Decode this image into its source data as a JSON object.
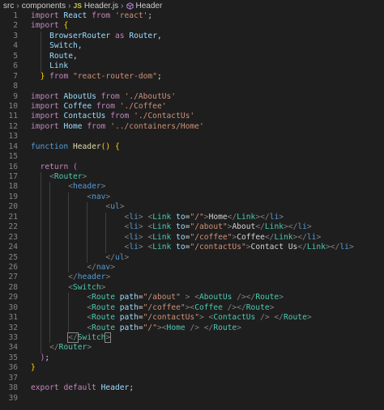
{
  "breadcrumb": {
    "items": [
      "src",
      "components",
      "Header.js",
      "Header"
    ],
    "file_badge": "JS"
  },
  "editor": {
    "lines": [
      {
        "n": "1",
        "tokens": [
          [
            "t-kw",
            "import "
          ],
          [
            "t-var",
            "React"
          ],
          [
            "t-kw",
            " from "
          ],
          [
            "t-str",
            "'react'"
          ],
          [
            "t-txt",
            ";"
          ]
        ]
      },
      {
        "n": "2",
        "tokens": [
          [
            "t-kw",
            "import "
          ],
          [
            "t-brace",
            "{"
          ]
        ]
      },
      {
        "n": "3",
        "tokens": [
          [
            "t-txt",
            "    "
          ],
          [
            "t-var",
            "BrowserRouter"
          ],
          [
            "t-kw",
            " as "
          ],
          [
            "t-var",
            "Router"
          ],
          [
            "t-txt",
            ","
          ]
        ]
      },
      {
        "n": "4",
        "tokens": [
          [
            "t-txt",
            "    "
          ],
          [
            "t-var",
            "Switch"
          ],
          [
            "t-txt",
            ","
          ]
        ]
      },
      {
        "n": "5",
        "tokens": [
          [
            "t-txt",
            "    "
          ],
          [
            "t-var",
            "Route"
          ],
          [
            "t-txt",
            ","
          ]
        ]
      },
      {
        "n": "6",
        "tokens": [
          [
            "t-txt",
            "    "
          ],
          [
            "t-var",
            "Link"
          ]
        ]
      },
      {
        "n": "7",
        "tokens": [
          [
            "t-txt",
            "  "
          ],
          [
            "t-brace",
            "}"
          ],
          [
            "t-kw",
            " from "
          ],
          [
            "t-str",
            "\"react-router-dom\""
          ],
          [
            "t-txt",
            ";"
          ]
        ]
      },
      {
        "n": "8",
        "tokens": []
      },
      {
        "n": "9",
        "tokens": [
          [
            "t-kw",
            "import "
          ],
          [
            "t-var",
            "AboutUs"
          ],
          [
            "t-kw",
            " from "
          ],
          [
            "t-str",
            "'./AboutUs'"
          ]
        ]
      },
      {
        "n": "10",
        "tokens": [
          [
            "t-kw",
            "import "
          ],
          [
            "t-var",
            "Coffee"
          ],
          [
            "t-kw",
            " from "
          ],
          [
            "t-str",
            "'./Coffee'"
          ]
        ]
      },
      {
        "n": "11",
        "tokens": [
          [
            "t-kw",
            "import "
          ],
          [
            "t-var",
            "ContactUs"
          ],
          [
            "t-kw",
            " from "
          ],
          [
            "t-str",
            "'./ContactUs'"
          ]
        ]
      },
      {
        "n": "12",
        "tokens": [
          [
            "t-kw",
            "import "
          ],
          [
            "t-var",
            "Home"
          ],
          [
            "t-kw",
            " from "
          ],
          [
            "t-str",
            "'../containers/Home'"
          ]
        ]
      },
      {
        "n": "13",
        "tokens": []
      },
      {
        "n": "14",
        "tokens": [
          [
            "t-kw2",
            "function "
          ],
          [
            "t-fn",
            "Header"
          ],
          [
            "t-brace",
            "()"
          ],
          [
            "t-txt",
            " "
          ],
          [
            "t-brace",
            "{"
          ]
        ]
      },
      {
        "n": "15",
        "tokens": []
      },
      {
        "n": "16",
        "tokens": [
          [
            "t-txt",
            "  "
          ],
          [
            "t-kw",
            "return "
          ],
          [
            "t-brace2",
            "("
          ]
        ]
      },
      {
        "n": "17",
        "tokens": [
          [
            "t-txt",
            "    "
          ],
          [
            "t-punc",
            "<"
          ],
          [
            "t-tag",
            "Router"
          ],
          [
            "t-punc",
            ">"
          ]
        ]
      },
      {
        "n": "18",
        "tokens": [
          [
            "t-txt",
            "        "
          ],
          [
            "t-punc",
            "<"
          ],
          [
            "t-kw2",
            "header"
          ],
          [
            "t-punc",
            ">"
          ]
        ]
      },
      {
        "n": "19",
        "tokens": [
          [
            "t-txt",
            "            "
          ],
          [
            "t-punc",
            "<"
          ],
          [
            "t-kw2",
            "nav"
          ],
          [
            "t-punc",
            ">"
          ]
        ]
      },
      {
        "n": "20",
        "tokens": [
          [
            "t-txt",
            "                "
          ],
          [
            "t-punc",
            "<"
          ],
          [
            "t-kw2",
            "ul"
          ],
          [
            "t-punc",
            ">"
          ]
        ]
      },
      {
        "n": "21",
        "tokens": [
          [
            "t-txt",
            "                    "
          ],
          [
            "t-punc",
            "<"
          ],
          [
            "t-kw2",
            "li"
          ],
          [
            "t-punc",
            ">"
          ],
          [
            "t-txt",
            " "
          ],
          [
            "t-punc",
            "<"
          ],
          [
            "t-tag",
            "Link"
          ],
          [
            "t-txt",
            " "
          ],
          [
            "t-attr",
            "to"
          ],
          [
            "t-txt",
            "="
          ],
          [
            "t-str",
            "\"/\""
          ],
          [
            "t-punc",
            ">"
          ],
          [
            "t-txt",
            "Home"
          ],
          [
            "t-punc",
            "</"
          ],
          [
            "t-tag",
            "Link"
          ],
          [
            "t-punc",
            "></"
          ],
          [
            "t-kw2",
            "li"
          ],
          [
            "t-punc",
            ">"
          ]
        ]
      },
      {
        "n": "22",
        "tokens": [
          [
            "t-txt",
            "                    "
          ],
          [
            "t-punc",
            "<"
          ],
          [
            "t-kw2",
            "li"
          ],
          [
            "t-punc",
            ">"
          ],
          [
            "t-txt",
            " "
          ],
          [
            "t-punc",
            "<"
          ],
          [
            "t-tag",
            "Link"
          ],
          [
            "t-txt",
            " "
          ],
          [
            "t-attr",
            "to"
          ],
          [
            "t-txt",
            "="
          ],
          [
            "t-str",
            "\"/about\""
          ],
          [
            "t-punc",
            ">"
          ],
          [
            "t-txt",
            "About"
          ],
          [
            "t-punc",
            "</"
          ],
          [
            "t-tag",
            "Link"
          ],
          [
            "t-punc",
            "></"
          ],
          [
            "t-kw2",
            "li"
          ],
          [
            "t-punc",
            ">"
          ]
        ]
      },
      {
        "n": "23",
        "tokens": [
          [
            "t-txt",
            "                    "
          ],
          [
            "t-punc",
            "<"
          ],
          [
            "t-kw2",
            "li"
          ],
          [
            "t-punc",
            ">"
          ],
          [
            "t-txt",
            " "
          ],
          [
            "t-punc",
            "<"
          ],
          [
            "t-tag",
            "Link"
          ],
          [
            "t-txt",
            " "
          ],
          [
            "t-attr",
            "to"
          ],
          [
            "t-txt",
            "="
          ],
          [
            "t-str",
            "\"/coffee\""
          ],
          [
            "t-punc",
            ">"
          ],
          [
            "t-txt",
            "Coffee"
          ],
          [
            "t-punc",
            "</"
          ],
          [
            "t-tag",
            "Link"
          ],
          [
            "t-punc",
            "></"
          ],
          [
            "t-kw2",
            "li"
          ],
          [
            "t-punc",
            ">"
          ]
        ]
      },
      {
        "n": "24",
        "tokens": [
          [
            "t-txt",
            "                    "
          ],
          [
            "t-punc",
            "<"
          ],
          [
            "t-kw2",
            "li"
          ],
          [
            "t-punc",
            ">"
          ],
          [
            "t-txt",
            " "
          ],
          [
            "t-punc",
            "<"
          ],
          [
            "t-tag",
            "Link"
          ],
          [
            "t-txt",
            " "
          ],
          [
            "t-attr",
            "to"
          ],
          [
            "t-txt",
            "="
          ],
          [
            "t-str",
            "\"/contactUs\""
          ],
          [
            "t-punc",
            ">"
          ],
          [
            "t-txt",
            "Contact Us"
          ],
          [
            "t-punc",
            "</"
          ],
          [
            "t-tag",
            "Link"
          ],
          [
            "t-punc",
            "></"
          ],
          [
            "t-kw2",
            "li"
          ],
          [
            "t-punc",
            ">"
          ]
        ]
      },
      {
        "n": "25",
        "tokens": [
          [
            "t-txt",
            "                "
          ],
          [
            "t-punc",
            "</"
          ],
          [
            "t-kw2",
            "ul"
          ],
          [
            "t-punc",
            ">"
          ]
        ]
      },
      {
        "n": "26",
        "tokens": [
          [
            "t-txt",
            "            "
          ],
          [
            "t-punc",
            "</"
          ],
          [
            "t-kw2",
            "nav"
          ],
          [
            "t-punc",
            ">"
          ]
        ]
      },
      {
        "n": "27",
        "tokens": [
          [
            "t-txt",
            "        "
          ],
          [
            "t-punc",
            "</"
          ],
          [
            "t-kw2",
            "header"
          ],
          [
            "t-punc",
            ">"
          ]
        ]
      },
      {
        "n": "28",
        "tokens": [
          [
            "t-txt",
            "        "
          ],
          [
            "t-punc",
            "<"
          ],
          [
            "t-tag",
            "Switch"
          ],
          [
            "t-punc",
            ">"
          ]
        ]
      },
      {
        "n": "29",
        "tokens": [
          [
            "t-txt",
            "            "
          ],
          [
            "t-punc",
            "<"
          ],
          [
            "t-tag",
            "Route"
          ],
          [
            "t-txt",
            " "
          ],
          [
            "t-attr",
            "path"
          ],
          [
            "t-txt",
            "="
          ],
          [
            "t-str",
            "\"/about\""
          ],
          [
            "t-txt",
            " "
          ],
          [
            "t-punc",
            ">"
          ],
          [
            "t-txt",
            " "
          ],
          [
            "t-punc",
            "<"
          ],
          [
            "t-tag",
            "AboutUs"
          ],
          [
            "t-txt",
            " "
          ],
          [
            "t-punc",
            "/></"
          ],
          [
            "t-tag",
            "Route"
          ],
          [
            "t-punc",
            ">"
          ]
        ]
      },
      {
        "n": "30",
        "tokens": [
          [
            "t-txt",
            "            "
          ],
          [
            "t-punc",
            "<"
          ],
          [
            "t-tag",
            "Route"
          ],
          [
            "t-txt",
            " "
          ],
          [
            "t-attr",
            "path"
          ],
          [
            "t-txt",
            "="
          ],
          [
            "t-str",
            "\"/coffee\""
          ],
          [
            "t-punc",
            ">"
          ],
          [
            "t-punc",
            "<"
          ],
          [
            "t-tag",
            "Coffee"
          ],
          [
            "t-txt",
            " "
          ],
          [
            "t-punc",
            "/></"
          ],
          [
            "t-tag",
            "Route"
          ],
          [
            "t-punc",
            ">"
          ]
        ]
      },
      {
        "n": "31",
        "tokens": [
          [
            "t-txt",
            "            "
          ],
          [
            "t-punc",
            "<"
          ],
          [
            "t-tag",
            "Route"
          ],
          [
            "t-txt",
            " "
          ],
          [
            "t-attr",
            "path"
          ],
          [
            "t-txt",
            "="
          ],
          [
            "t-str",
            "\"/contactUs\""
          ],
          [
            "t-punc",
            ">"
          ],
          [
            "t-txt",
            " "
          ],
          [
            "t-punc",
            "<"
          ],
          [
            "t-tag",
            "ContactUs"
          ],
          [
            "t-txt",
            " "
          ],
          [
            "t-punc",
            "/> </"
          ],
          [
            "t-tag",
            "Route"
          ],
          [
            "t-punc",
            ">"
          ]
        ]
      },
      {
        "n": "32",
        "tokens": [
          [
            "t-txt",
            "            "
          ],
          [
            "t-punc",
            "<"
          ],
          [
            "t-tag",
            "Route"
          ],
          [
            "t-txt",
            " "
          ],
          [
            "t-attr",
            "path"
          ],
          [
            "t-txt",
            "="
          ],
          [
            "t-str",
            "\"/\""
          ],
          [
            "t-punc",
            ">"
          ],
          [
            "t-punc",
            "<"
          ],
          [
            "t-tag",
            "Home"
          ],
          [
            "t-txt",
            " "
          ],
          [
            "t-punc",
            "/> </"
          ],
          [
            "t-tag",
            "Route"
          ],
          [
            "t-punc",
            ">"
          ]
        ]
      },
      {
        "n": "33",
        "tokens": [
          [
            "t-txt",
            "        "
          ],
          [
            "t-punc",
            "</"
          ],
          [
            "t-tag",
            "Switch"
          ],
          [
            "t-punc",
            ">"
          ]
        ]
      },
      {
        "n": "34",
        "tokens": [
          [
            "t-txt",
            "    "
          ],
          [
            "t-punc",
            "</"
          ],
          [
            "t-tag",
            "Router"
          ],
          [
            "t-punc",
            ">"
          ]
        ]
      },
      {
        "n": "35",
        "tokens": [
          [
            "t-txt",
            "  "
          ],
          [
            "t-brace2",
            ")"
          ],
          [
            "t-txt",
            ";"
          ]
        ]
      },
      {
        "n": "36",
        "tokens": [
          [
            "t-brace",
            "}"
          ]
        ]
      },
      {
        "n": "37",
        "tokens": []
      },
      {
        "n": "38",
        "tokens": [
          [
            "t-kw",
            "export "
          ],
          [
            "t-kw",
            "default "
          ],
          [
            "t-var",
            "Header"
          ],
          [
            "t-txt",
            ";"
          ]
        ]
      },
      {
        "n": "39",
        "tokens": []
      }
    ]
  }
}
